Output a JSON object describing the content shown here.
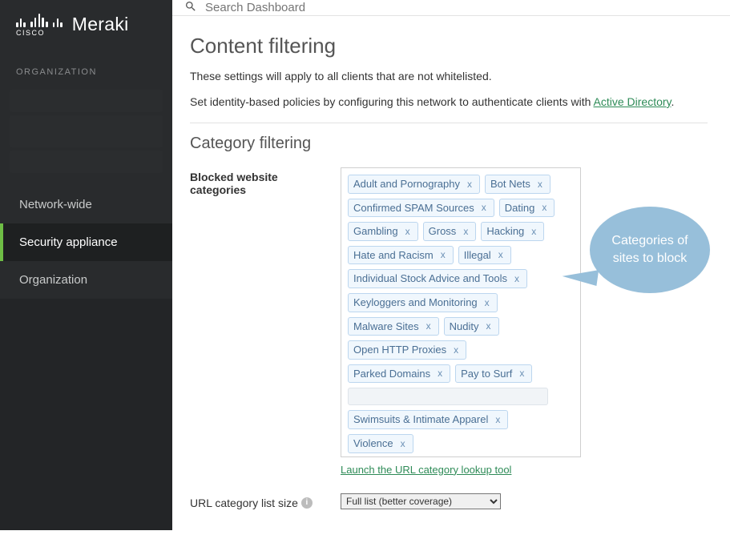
{
  "logo": {
    "brand_small": "CISCO",
    "brand": "Meraki"
  },
  "sidebar": {
    "section_label": "ORGANIZATION",
    "items": [
      {
        "label": "Network-wide"
      },
      {
        "label": "Security appliance"
      },
      {
        "label": "Organization"
      }
    ]
  },
  "search": {
    "placeholder": "Search Dashboard"
  },
  "page": {
    "title": "Content filtering",
    "desc1": "These settings will apply to all clients that are not whitelisted.",
    "desc2_prefix": "Set identity-based policies by configuring this network to authenticate clients with ",
    "desc2_link": "Active Directory",
    "desc2_suffix": "."
  },
  "section": {
    "title": "Category filtering"
  },
  "blocked": {
    "label": "Blocked website categories",
    "tags": [
      "Adult and Pornography",
      "Bot Nets",
      "Confirmed SPAM Sources",
      "Dating",
      "Gambling",
      "Gross",
      "Hacking",
      "Hate and Racism",
      "Illegal",
      "Individual Stock Advice and Tools",
      "Keyloggers and Monitoring",
      "Malware Sites",
      "Nudity",
      "Open HTTP Proxies",
      "Parked Domains",
      "Pay to Surf",
      "",
      "Swimsuits & Intimate Apparel",
      "Violence"
    ],
    "launch_link": "Launch the URL category lookup tool"
  },
  "listsize": {
    "label": "URL category list size",
    "info": "i",
    "options": [
      "Full list (better coverage)"
    ],
    "selected": "Full list (better coverage)"
  },
  "bubble": {
    "text": "Categories of sites to block"
  }
}
